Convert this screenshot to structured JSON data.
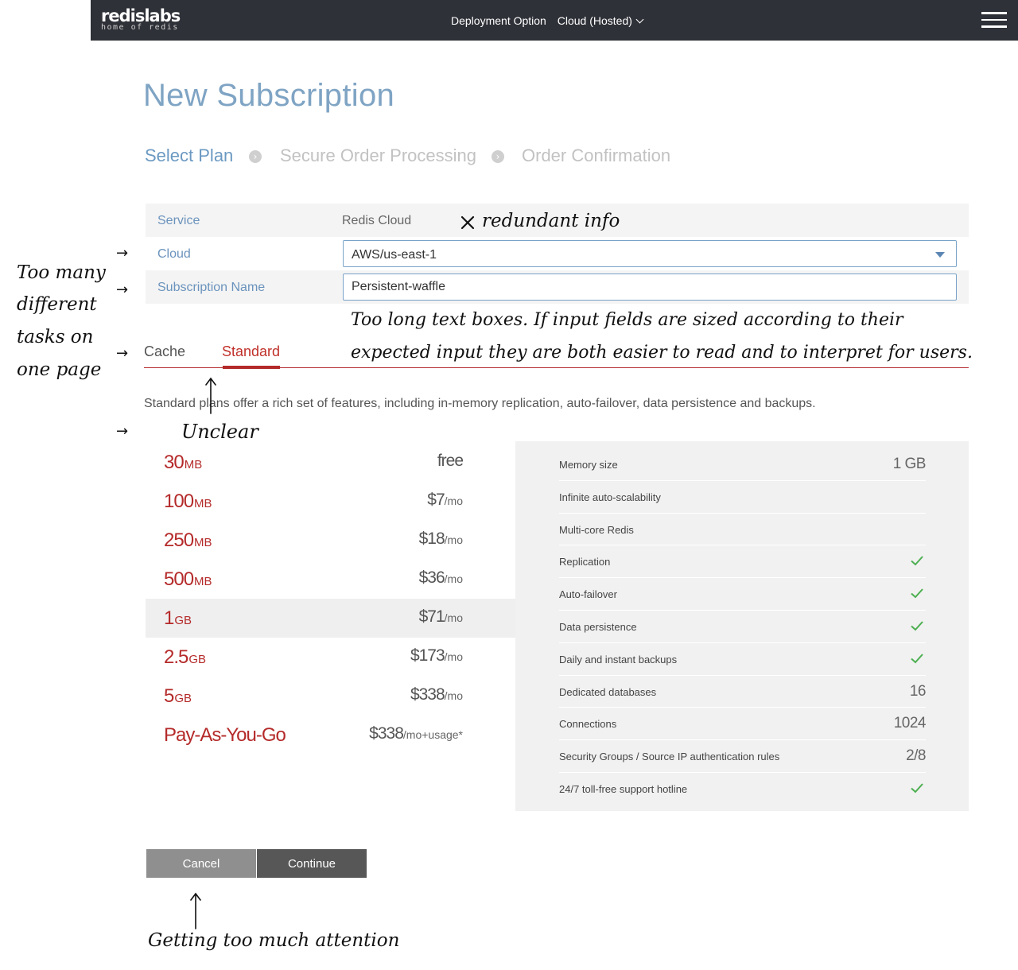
{
  "header": {
    "logo_main": "redislabs",
    "logo_tagline": "home of redis",
    "deployment_label": "Deployment Option",
    "deployment_value": "Cloud (Hosted)"
  },
  "page_title": "New Subscription",
  "steps": [
    "Select Plan",
    "Secure Order Processing",
    "Order Confirmation"
  ],
  "form": {
    "service_label": "Service",
    "service_value": "Redis Cloud",
    "cloud_label": "Cloud",
    "cloud_value": "AWS/us-east-1",
    "subscription_label": "Subscription Name",
    "subscription_value": "Persistent-waffle"
  },
  "tabs": {
    "cache": "Cache",
    "standard": "Standard"
  },
  "description": "Standard plans offer a rich set of features, including in-memory replication, auto-failover, data persistence and backups.",
  "plans": [
    {
      "size": "30",
      "unit": "MB",
      "price": "free",
      "per": ""
    },
    {
      "size": "100",
      "unit": "MB",
      "price": "$7",
      "per": "/mo"
    },
    {
      "size": "250",
      "unit": "MB",
      "price": "$18",
      "per": "/mo"
    },
    {
      "size": "500",
      "unit": "MB",
      "price": "$36",
      "per": "/mo"
    },
    {
      "size": "1",
      "unit": "GB",
      "price": "$71",
      "per": "/mo"
    },
    {
      "size": "2.5",
      "unit": "GB",
      "price": "$173",
      "per": "/mo"
    },
    {
      "size": "5",
      "unit": "GB",
      "price": "$338",
      "per": "/mo"
    },
    {
      "size": "Pay-As-You-Go",
      "unit": "",
      "price": "$338",
      "per": "/mo+usage*"
    }
  ],
  "features": [
    {
      "label": "Memory size",
      "value": "1 GB"
    },
    {
      "label": "Infinite auto-scalability",
      "value": ""
    },
    {
      "label": "Multi-core Redis",
      "value": ""
    },
    {
      "label": "Replication",
      "value": "check"
    },
    {
      "label": "Auto-failover",
      "value": "check"
    },
    {
      "label": "Data persistence",
      "value": "check"
    },
    {
      "label": "Daily and instant backups",
      "value": "check"
    },
    {
      "label": "Dedicated databases",
      "value": "16"
    },
    {
      "label": "Connections",
      "value": "1024"
    },
    {
      "label": "Security Groups / Source IP authentication rules",
      "value": "2/8"
    },
    {
      "label": "24/7 toll-free support hotline",
      "value": "check"
    }
  ],
  "buttons": {
    "cancel": "Cancel",
    "continue": "Continue"
  },
  "annotations": {
    "redundant": "redundant info",
    "too_many_1": "Too many",
    "too_many_2": "different",
    "too_many_3": "tasks on",
    "too_many_4": "one page",
    "text_boxes_1": "Too long text boxes. If input fields are sized according to their",
    "text_boxes_2": "expected input they are both easier to read and to interpret for users.",
    "unclear": "Unclear",
    "attention": "Getting too much attention"
  },
  "colors": {
    "header_bg": "#2f3138",
    "title_blue": "#7fa4c4",
    "accent_red": "#b52a2a",
    "check_green": "#4caf50",
    "button_cancel": "#8f8f8f",
    "button_continue": "#575757"
  }
}
